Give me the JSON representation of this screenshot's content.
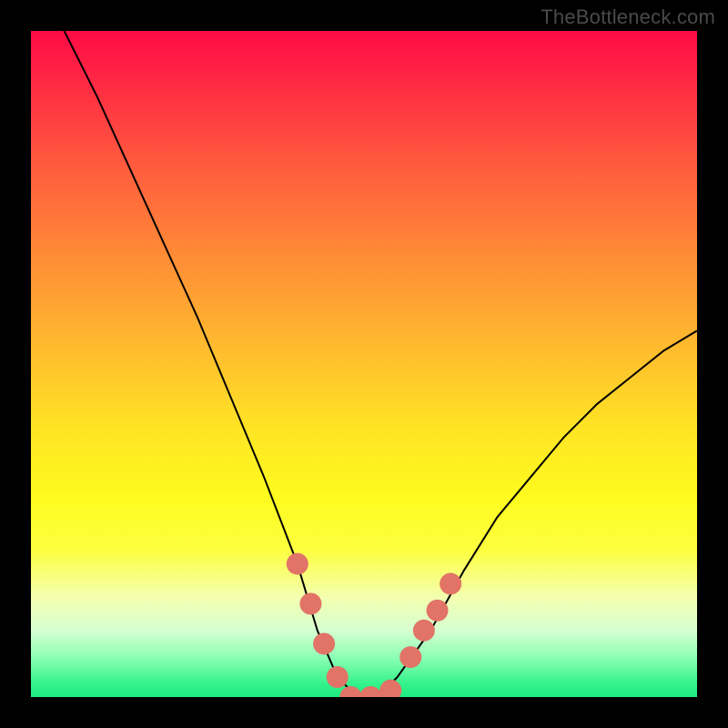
{
  "watermark": "TheBottleneck.com",
  "chart_data": {
    "type": "line",
    "title": "",
    "xlabel": "",
    "ylabel": "",
    "xlim": [
      0,
      100
    ],
    "ylim": [
      0,
      100
    ],
    "grid": false,
    "series": [
      {
        "name": "bottleneck-curve",
        "x": [
          5,
          10,
          15,
          20,
          25,
          30,
          35,
          40,
          43,
          46,
          49,
          52,
          55,
          60,
          65,
          70,
          75,
          80,
          85,
          90,
          95,
          100
        ],
        "y": [
          100,
          90,
          79,
          68,
          57,
          45,
          33,
          20,
          10,
          3,
          0,
          0,
          3,
          10,
          19,
          27,
          33,
          39,
          44,
          48,
          52,
          55
        ]
      }
    ],
    "markers": [
      {
        "name": "left-marker-1",
        "x": 40,
        "y": 20
      },
      {
        "name": "left-marker-2",
        "x": 42,
        "y": 14
      },
      {
        "name": "left-marker-3",
        "x": 44,
        "y": 8
      },
      {
        "name": "left-marker-4",
        "x": 46,
        "y": 3
      },
      {
        "name": "bottom-marker-1",
        "x": 48,
        "y": 0
      },
      {
        "name": "bottom-marker-2",
        "x": 51,
        "y": 0
      },
      {
        "name": "bottom-marker-3",
        "x": 54,
        "y": 1
      },
      {
        "name": "right-marker-1",
        "x": 57,
        "y": 6
      },
      {
        "name": "right-marker-2",
        "x": 59,
        "y": 10
      },
      {
        "name": "right-marker-3",
        "x": 61,
        "y": 13
      },
      {
        "name": "right-marker-4",
        "x": 63,
        "y": 17
      }
    ],
    "background_gradient": {
      "top": "#ff0b45",
      "mid": "#fffb1f",
      "bottom": "#1de982"
    },
    "marker_color": "#e17367",
    "curve_color": "#000000"
  }
}
